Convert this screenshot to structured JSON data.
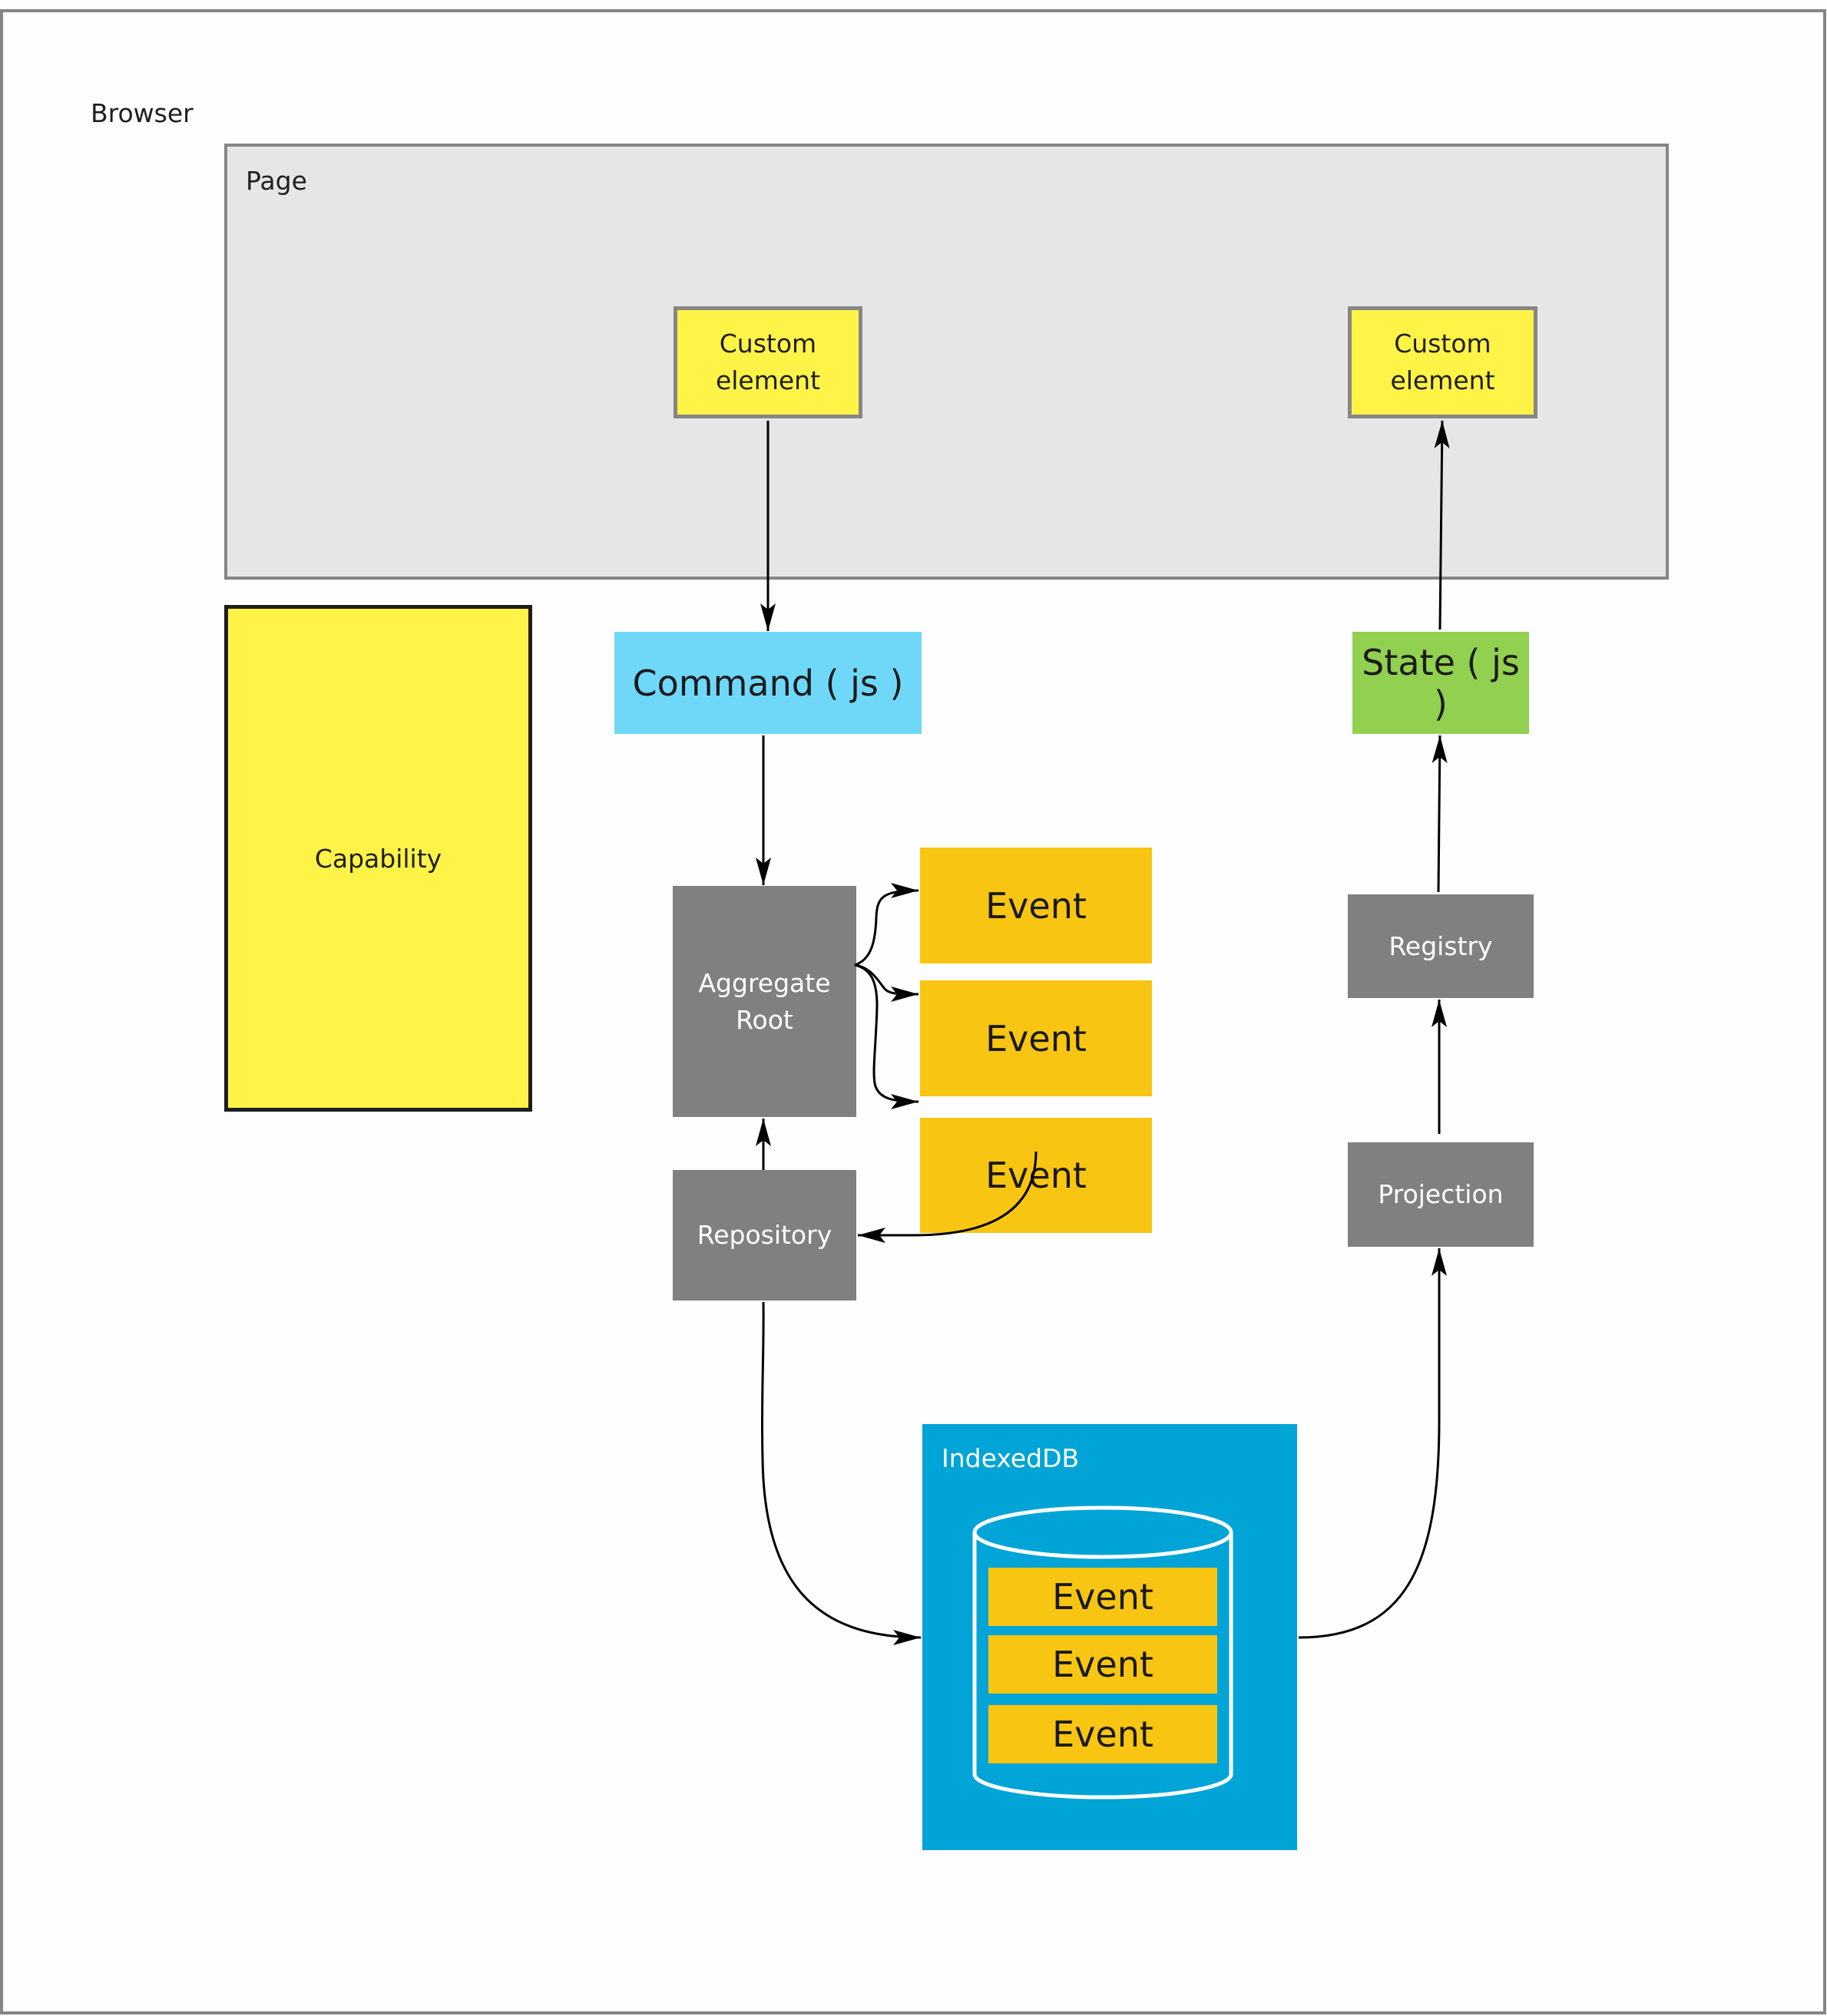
{
  "browser": {
    "label": "Browser"
  },
  "page": {
    "label": "Page",
    "custom_elements": [
      {
        "label": "Custom\nelement",
        "line1": "Custom",
        "line2": "element"
      },
      {
        "label": "Custom\nelement",
        "line1": "Custom",
        "line2": "element"
      }
    ]
  },
  "capability": {
    "label": "Capability"
  },
  "command": {
    "label": "Command ( js )"
  },
  "state": {
    "label": "State ( js )"
  },
  "aggregate_root": {
    "line1": "Aggregate",
    "line2": "Root"
  },
  "events": [
    {
      "label": "Event"
    },
    {
      "label": "Event"
    },
    {
      "label": "Event"
    }
  ],
  "repository": {
    "label": "Repository"
  },
  "registry": {
    "label": "Registry"
  },
  "projection": {
    "label": "Projection"
  },
  "indexeddb": {
    "label": "IndexedDB",
    "stored_events": [
      {
        "label": "Event"
      },
      {
        "label": "Event"
      },
      {
        "label": "Event"
      }
    ]
  },
  "colors": {
    "frame_border": "#858585",
    "page_bg": "#e6e6e6",
    "custom_element": "#fff347",
    "command": "#6fd8f9",
    "state": "#92d050",
    "node_gray": "#808080",
    "event": "#f8c512",
    "indexeddb": "#00a4d6"
  },
  "connections": [
    {
      "from": "custom-element-left",
      "to": "command"
    },
    {
      "from": "command",
      "to": "aggregate-root"
    },
    {
      "from": "aggregate-root",
      "to": "event-1"
    },
    {
      "from": "aggregate-root",
      "to": "event-2"
    },
    {
      "from": "aggregate-root",
      "to": "event-3"
    },
    {
      "from": "event-3",
      "to": "repository"
    },
    {
      "from": "repository",
      "to": "aggregate-root"
    },
    {
      "from": "repository",
      "to": "indexeddb"
    },
    {
      "from": "indexeddb",
      "to": "projection"
    },
    {
      "from": "projection",
      "to": "registry"
    },
    {
      "from": "registry",
      "to": "state"
    },
    {
      "from": "state",
      "to": "custom-element-right"
    }
  ]
}
